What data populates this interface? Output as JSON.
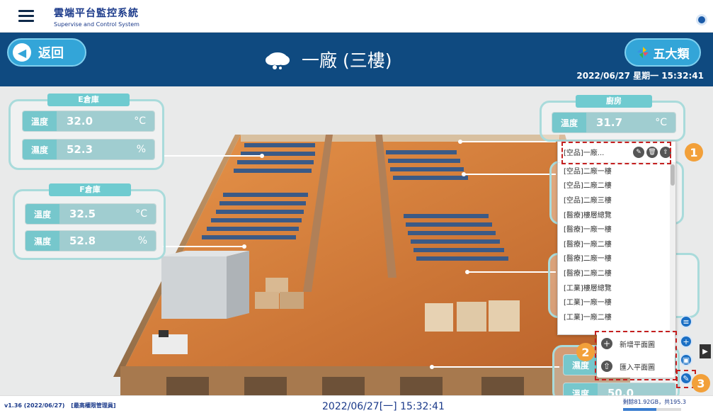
{
  "header": {
    "app_title": "雲端平台監控系統",
    "app_subtitle": "Supervise and Control System"
  },
  "band": {
    "back_label": "返回",
    "title": "一廠 (三樓)",
    "category_button": "五大類",
    "datetime": "2022/06/27 星期一 15:32:41"
  },
  "panels": [
    {
      "name": "E倉庫",
      "rows": [
        {
          "label": "溫度",
          "value": "32.0",
          "unit": "°C"
        },
        {
          "label": "濕度",
          "value": "52.3",
          "unit": "%"
        }
      ]
    },
    {
      "name": "F倉庫",
      "rows": [
        {
          "label": "溫度",
          "value": "32.5",
          "unit": "°C"
        },
        {
          "label": "濕度",
          "value": "52.8",
          "unit": "%"
        }
      ]
    },
    {
      "name": "廚房",
      "rows": [
        {
          "label": "溫度",
          "value": "31.7",
          "unit": "°C"
        }
      ]
    }
  ],
  "dropdown": {
    "selected": "[空品]一廠...",
    "items": [
      "[空品]二廠一樓",
      "[空品]二廠二樓",
      "[空品]二廠三樓",
      "[醫療]樓層總覽",
      "[醫療]一廠一樓",
      "[醫療]一廠二樓",
      "[醫療]二廠一樓",
      "[醫療]二廠二樓",
      "[工業]樓層總覽",
      "[工業]一廠一樓",
      "[工業]一廠二樓"
    ]
  },
  "add_menu": {
    "add_floorplan": "新增平面圖",
    "import_floorplan": "匯入平面圖"
  },
  "partial_panel": {
    "label": "濕度",
    "label2": "溫度",
    "value": "50.0"
  },
  "badges": [
    "1",
    "2",
    "3"
  ],
  "footer": {
    "version": "v1.36 (2022/06/27)",
    "role": "[最高權限管理員]",
    "datetime": "2022/06/27[一] 15:32:41",
    "storage": "剩餘81.92GB，共195.3",
    "storage_used_fraction": 0.58
  },
  "colors": {
    "band": "#0f4a80",
    "accent": "#33a5d8",
    "panel_teal": "#76c7cc",
    "highlight": "#c42020",
    "badge": "#f2a03a"
  }
}
